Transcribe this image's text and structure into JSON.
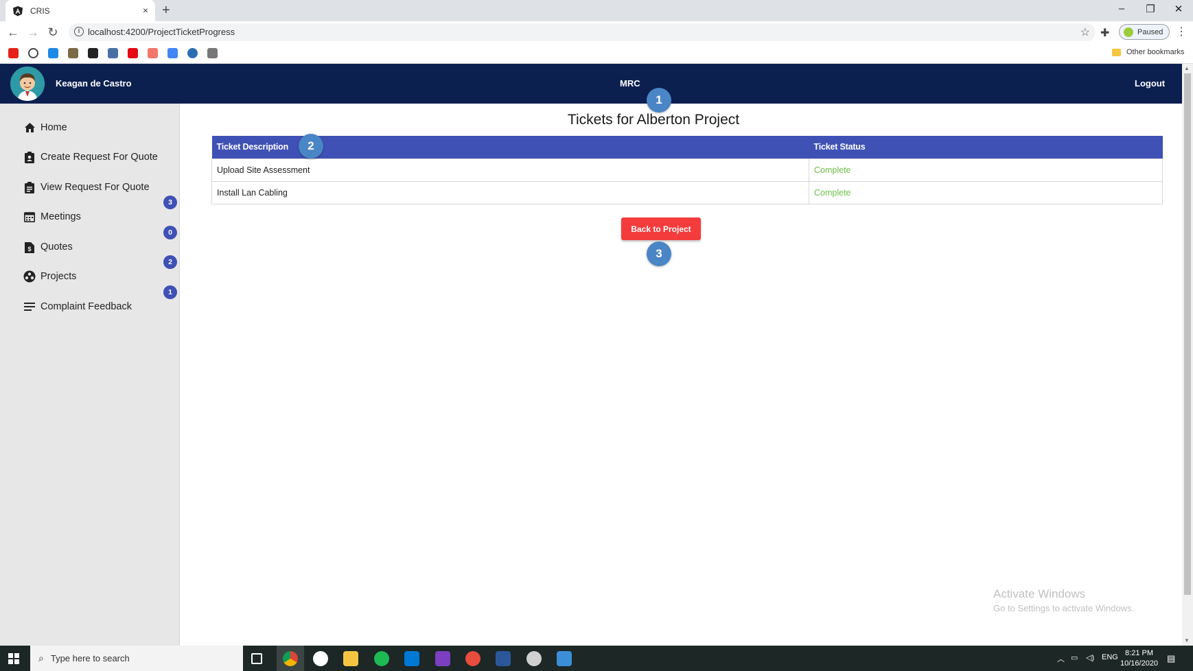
{
  "browser": {
    "tab_title": "CRIS",
    "tab_close": "×",
    "new_tab": "+",
    "url": "localhost:4200/ProjectTicketProgress",
    "profile_status": "Paused",
    "other_bookmarks": "Other bookmarks",
    "window_minimize": "–",
    "window_restore": "❐",
    "window_close": "✕"
  },
  "header": {
    "user_name": "Keagan de Castro",
    "brand": "MRC",
    "logout_label": "Logout"
  },
  "sidebar": {
    "items": [
      {
        "label": "Home",
        "icon": "home-icon"
      },
      {
        "label": "Create Request For Quote",
        "icon": "clipboard-user-icon"
      },
      {
        "label": "View Request For Quote",
        "icon": "clipboard-list-icon"
      },
      {
        "label": "Meetings",
        "icon": "calendar-icon"
      },
      {
        "label": "Quotes",
        "icon": "dollar-file-icon"
      },
      {
        "label": "Projects",
        "icon": "group-icon"
      },
      {
        "label": "Complaint Feedback",
        "icon": "lines-icon"
      }
    ],
    "badges": [
      "3",
      "0",
      "2",
      "1"
    ]
  },
  "main": {
    "title": "Tickets for Alberton Project",
    "table": {
      "headers": [
        "Ticket Description",
        "Ticket Status"
      ],
      "rows": [
        {
          "description": "Upload Site Assessment",
          "status": "Complete"
        },
        {
          "description": "Install Lan Cabling",
          "status": "Complete"
        }
      ]
    },
    "back_button": "Back to Project"
  },
  "step_markers": [
    "1",
    "2",
    "3"
  ],
  "watermark": {
    "line1": "Activate Windows",
    "line2": "Go to Settings to activate Windows."
  },
  "taskbar": {
    "search_placeholder": "Type here to search",
    "language": "ENG",
    "time": "8:21 PM",
    "date": "10/16/2020"
  },
  "colors": {
    "header_bg": "#0c2050",
    "table_header_bg": "#3f51b5",
    "status_complete": "#6fc04a",
    "back_button_bg": "#f43c3c",
    "badge_bg": "#3f51b5",
    "step_marker_bg": "#4a86c5"
  }
}
